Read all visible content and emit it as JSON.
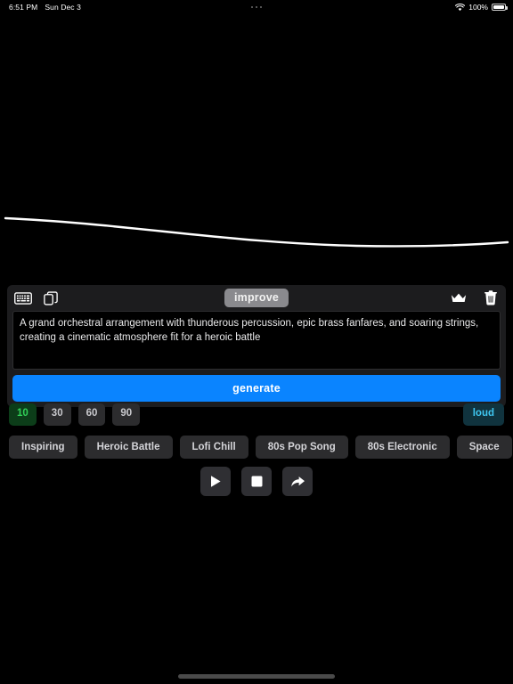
{
  "statusbar": {
    "time": "6:51 PM",
    "date": "Sun Dec 3",
    "multitask_icon": "three-dots-icon",
    "wifi_icon": "wifi-icon",
    "battery_percent": "100%",
    "battery_icon": "battery-full-icon"
  },
  "waveform": {
    "name": "audio-waveform",
    "color": "#ffffff"
  },
  "card": {
    "toolbar": {
      "keyboard_icon": "keyboard-icon",
      "copy_icon": "copy-icon",
      "improve_label": "improve",
      "crown_icon": "crown-icon",
      "trash_icon": "trash-icon"
    },
    "prompt": {
      "value": "A grand orchestral arrangement with thunderous percussion, epic brass fanfares, and soaring strings, creating a cinematic atmosphere fit for a heroic battle",
      "placeholder": "Describe the music you want to generate"
    },
    "generate_label": "generate",
    "generate_color": "#0a84ff"
  },
  "duration": {
    "options": [
      "10",
      "30",
      "60",
      "90"
    ],
    "selected": "10",
    "selected_bg": "#0c3d19",
    "selected_fg": "#31d158"
  },
  "volume": {
    "label": "loud",
    "bg": "#10333e",
    "fg": "#3fc6f0"
  },
  "presets": [
    {
      "label": "Inspiring"
    },
    {
      "label": "Heroic Battle"
    },
    {
      "label": "Lofi Chill"
    },
    {
      "label": "80s Pop Song"
    },
    {
      "label": "80s Electronic"
    },
    {
      "label": "Space"
    }
  ],
  "transport": {
    "play_icon": "play-icon",
    "stop_icon": "stop-icon",
    "share_icon": "share-arrow-icon"
  }
}
